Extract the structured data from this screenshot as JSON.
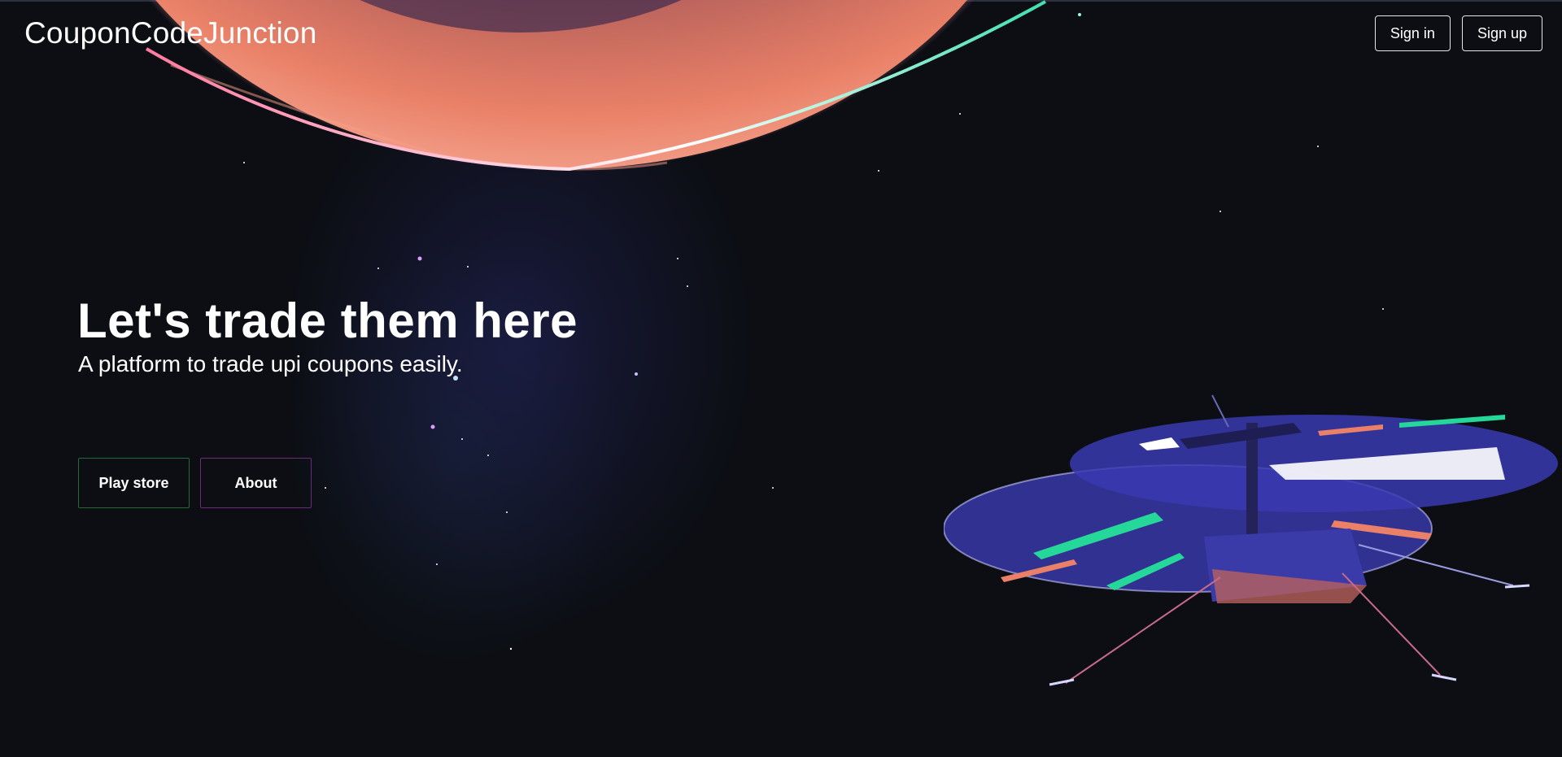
{
  "header": {
    "brand": "CouponCodeJunction",
    "sign_in_label": "Sign in",
    "sign_up_label": "Sign up"
  },
  "hero": {
    "title": "Let's trade them here",
    "subtitle": "A platform to trade upi coupons easily.",
    "play_store_label": "Play store",
    "about_label": "About"
  },
  "colors": {
    "background": "#0c0e13",
    "planet": "#d8755c",
    "planet_glow": "#ffffff",
    "play_store_border": "#1f6b3a",
    "about_border": "#6b2a7a",
    "helicopter_blue": "#3a3aa8",
    "rotor_accent_green": "#25d89a"
  },
  "illustrations": [
    "planet",
    "starfield",
    "helicopter"
  ]
}
